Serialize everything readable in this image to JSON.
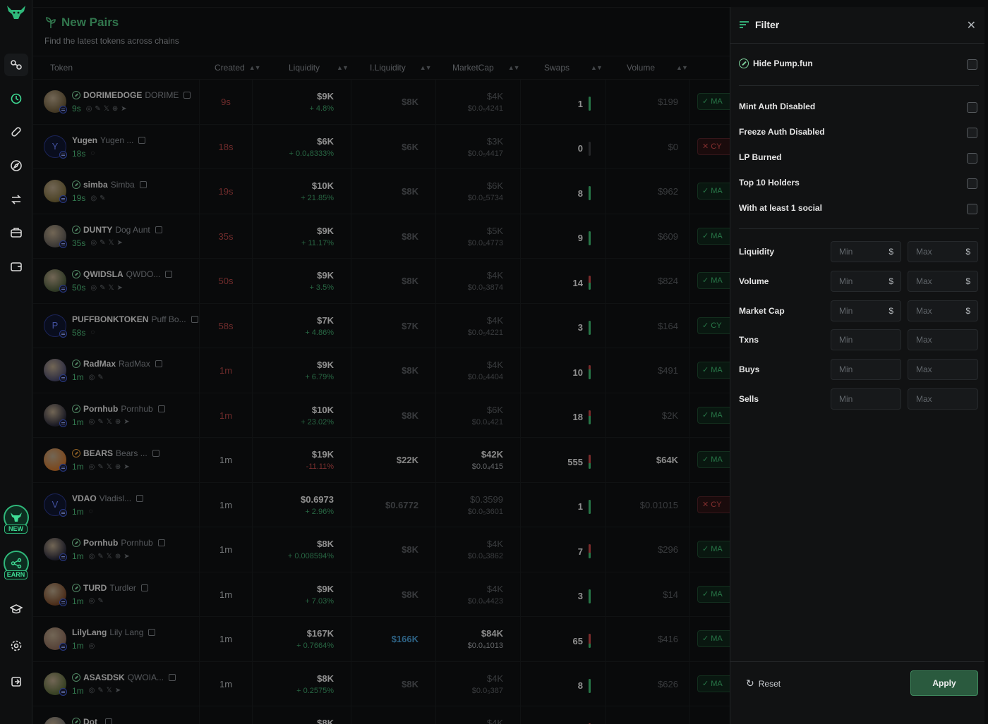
{
  "page": {
    "title": "New Pairs",
    "subtitle": "Find the latest tokens across chains"
  },
  "rail": {
    "promo_new": "NEW",
    "promo_earn": "EARN"
  },
  "table": {
    "headers": {
      "token": "Token",
      "created": "Created",
      "liquidity": "Liquidity",
      "iliquidity": "I.Liquidity",
      "marketcap": "MarketCap",
      "swaps": "Swaps",
      "volume": "Volume"
    },
    "rows": [
      {
        "sym": "DORIMEDOGE",
        "name": "DORIME",
        "age": "9s",
        "created": "9s",
        "created_style": "red",
        "liq": "$9K",
        "liq_chg": "+ 4.8%",
        "liq_neg": false,
        "iliq": "$8K",
        "iliq_style": "",
        "mc": "$4K",
        "mc_sub": "$0.0₅4241",
        "mc_white": false,
        "swaps": "1",
        "buy_ratio": 1.0,
        "vol": "$199",
        "vol_white": false,
        "audit": "✓ MA",
        "audit_bad": false,
        "avatar": "img",
        "pump": true,
        "pump_orange": false,
        "meta": [
          "◎",
          "✎",
          "𝕏",
          "⊕",
          "➤"
        ]
      },
      {
        "sym": "Yugen",
        "name": "Yugen ...",
        "age": "18s",
        "created": "18s",
        "created_style": "red",
        "liq": "$6K",
        "liq_chg": "+ 0.0₄8333%",
        "liq_neg": false,
        "iliq": "$6K",
        "iliq_style": "",
        "mc": "$3K",
        "mc_sub": "$0.0₅4417",
        "mc_white": false,
        "swaps": "0",
        "buy_ratio": 0,
        "vol": "$0",
        "vol_white": false,
        "audit": "✕ CY",
        "audit_bad": true,
        "avatar": "Y",
        "pump": false,
        "pump_orange": false,
        "meta": [
          "◌"
        ]
      },
      {
        "sym": "simba",
        "name": "Simba",
        "age": "19s",
        "created": "19s",
        "created_style": "red",
        "liq": "$10K",
        "liq_chg": "+ 21.85%",
        "liq_neg": false,
        "iliq": "$8K",
        "iliq_style": "",
        "mc": "$6K",
        "mc_sub": "$0.0₅5734",
        "mc_white": false,
        "swaps": "8",
        "buy_ratio": 1.0,
        "vol": "$962",
        "vol_white": false,
        "audit": "✓ MA",
        "audit_bad": false,
        "avatar": "img",
        "pump": true,
        "pump_orange": false,
        "meta": [
          "◎",
          "✎"
        ]
      },
      {
        "sym": "DUNTY",
        "name": "Dog Aunt",
        "age": "35s",
        "created": "35s",
        "created_style": "red",
        "liq": "$9K",
        "liq_chg": "+ 11.17%",
        "liq_neg": false,
        "iliq": "$8K",
        "iliq_style": "",
        "mc": "$5K",
        "mc_sub": "$0.0₅4773",
        "mc_white": false,
        "swaps": "9",
        "buy_ratio": 1.0,
        "vol": "$609",
        "vol_white": false,
        "audit": "✓ MA",
        "audit_bad": false,
        "avatar": "img",
        "pump": true,
        "pump_orange": false,
        "meta": [
          "◎",
          "✎",
          "𝕏",
          "➤"
        ]
      },
      {
        "sym": "QWIDSLA",
        "name": "QWDO...",
        "age": "50s",
        "created": "50s",
        "created_style": "red",
        "liq": "$9K",
        "liq_chg": "+ 3.5%",
        "liq_neg": false,
        "iliq": "$8K",
        "iliq_style": "",
        "mc": "$4K",
        "mc_sub": "$0.0₅3874",
        "mc_white": false,
        "swaps": "14",
        "buy_ratio": 0.5,
        "vol": "$824",
        "vol_white": false,
        "audit": "✓ MA",
        "audit_bad": false,
        "avatar": "img",
        "pump": true,
        "pump_orange": false,
        "meta": [
          "◎",
          "✎",
          "𝕏",
          "➤"
        ]
      },
      {
        "sym": "PUFFBONKTOKEN",
        "name": "Puff Bo...",
        "age": "58s",
        "created": "58s",
        "created_style": "red",
        "liq": "$7K",
        "liq_chg": "+ 4.86%",
        "liq_neg": false,
        "iliq": "$7K",
        "iliq_style": "",
        "mc": "$4K",
        "mc_sub": "$0.0₅4221",
        "mc_white": false,
        "swaps": "3",
        "buy_ratio": 1.0,
        "vol": "$164",
        "vol_white": false,
        "audit": "✓ CY",
        "audit_bad": false,
        "avatar": "P",
        "pump": false,
        "pump_orange": false,
        "meta": [
          "◌"
        ]
      },
      {
        "sym": "RadMax",
        "name": "RadMax",
        "age": "1m",
        "created": "1m",
        "created_style": "red",
        "liq": "$9K",
        "liq_chg": "+ 6.79%",
        "liq_neg": false,
        "iliq": "$8K",
        "iliq_style": "",
        "mc": "$4K",
        "mc_sub": "$0.0₅4404",
        "mc_white": false,
        "swaps": "10",
        "buy_ratio": 0.7,
        "vol": "$491",
        "vol_white": false,
        "audit": "✓ MA",
        "audit_bad": false,
        "avatar": "img",
        "pump": true,
        "pump_orange": false,
        "meta": [
          "◎",
          "✎"
        ]
      },
      {
        "sym": "Pornhub",
        "name": "Pornhub",
        "age": "1m",
        "created": "1m",
        "created_style": "red",
        "liq": "$10K",
        "liq_chg": "+ 23.02%",
        "liq_neg": false,
        "iliq": "$8K",
        "iliq_style": "",
        "mc": "$6K",
        "mc_sub": "$0.0₅421",
        "mc_white": false,
        "swaps": "18",
        "buy_ratio": 0.6,
        "vol": "$2K",
        "vol_white": false,
        "audit": "✓ MA",
        "audit_bad": false,
        "avatar": "img",
        "pump": true,
        "pump_orange": false,
        "meta": [
          "◎",
          "✎",
          "𝕏",
          "⊕",
          "➤"
        ]
      },
      {
        "sym": "BEARS",
        "name": "Bears ...",
        "age": "1m",
        "created": "1m",
        "created_style": "grey",
        "liq": "$19K",
        "liq_chg": "-11.11%",
        "liq_neg": true,
        "iliq": "$22K",
        "iliq_style": "white",
        "mc": "$42K",
        "mc_sub": "$0.0₄415",
        "mc_white": true,
        "swaps": "555",
        "buy_ratio": 0.4,
        "vol": "$64K",
        "vol_white": true,
        "audit": "✓ MA",
        "audit_bad": false,
        "avatar": "img",
        "pump": true,
        "pump_orange": true,
        "meta": [
          "◎",
          "✎",
          "𝕏",
          "⊕",
          "➤"
        ]
      },
      {
        "sym": "VDAO",
        "name": "Vladisl...",
        "age": "1m",
        "created": "1m",
        "created_style": "grey",
        "liq": "$0.6973",
        "liq_chg": "+ 2.96%",
        "liq_neg": false,
        "iliq": "$0.6772",
        "iliq_style": "",
        "mc": "$0.3599",
        "mc_sub": "$0.0₅3601",
        "mc_white": false,
        "swaps": "1",
        "buy_ratio": 1.0,
        "vol": "$0.01015",
        "vol_white": false,
        "audit": "✕ CY",
        "audit_bad": true,
        "avatar": "V",
        "pump": false,
        "pump_orange": false,
        "meta": [
          "◌"
        ]
      },
      {
        "sym": "Pornhub",
        "name": "Pornhub",
        "age": "1m",
        "created": "1m",
        "created_style": "grey",
        "liq": "$8K",
        "liq_chg": "+ 0.008594%",
        "liq_neg": false,
        "iliq": "$8K",
        "iliq_style": "",
        "mc": "$4K",
        "mc_sub": "$0.0₅3862",
        "mc_white": false,
        "swaps": "7",
        "buy_ratio": 0.4,
        "vol": "$296",
        "vol_white": false,
        "audit": "✓ MA",
        "audit_bad": false,
        "avatar": "img",
        "pump": true,
        "pump_orange": false,
        "meta": [
          "◎",
          "✎",
          "𝕏",
          "⊕",
          "➤"
        ]
      },
      {
        "sym": "TURD",
        "name": "Turdler",
        "age": "1m",
        "created": "1m",
        "created_style": "grey",
        "liq": "$9K",
        "liq_chg": "+ 7.03%",
        "liq_neg": false,
        "iliq": "$8K",
        "iliq_style": "",
        "mc": "$4K",
        "mc_sub": "$0.0₅4423",
        "mc_white": false,
        "swaps": "3",
        "buy_ratio": 1.0,
        "vol": "$14",
        "vol_white": false,
        "audit": "✓ MA",
        "audit_bad": false,
        "avatar": "img",
        "pump": true,
        "pump_orange": false,
        "meta": [
          "◎",
          "✎"
        ]
      },
      {
        "sym": "LilyLang",
        "name": "Lily Lang",
        "age": "1m",
        "created": "1m",
        "created_style": "grey",
        "liq": "$167K",
        "liq_chg": "+ 0.7664%",
        "liq_neg": false,
        "iliq": "$166K",
        "iliq_style": "blue",
        "mc": "$84K",
        "mc_sub": "$0.0₄1013",
        "mc_white": true,
        "swaps": "65",
        "buy_ratio": 0.3,
        "vol": "$416",
        "vol_white": false,
        "audit": "✓ MA",
        "audit_bad": false,
        "avatar": "img",
        "pump": false,
        "pump_orange": false,
        "meta": [
          "◎"
        ]
      },
      {
        "sym": "ASASDSK",
        "name": "QWOIA...",
        "age": "1m",
        "created": "1m",
        "created_style": "grey",
        "liq": "$8K",
        "liq_chg": "+ 0.2575%",
        "liq_neg": false,
        "iliq": "$8K",
        "iliq_style": "",
        "mc": "$4K",
        "mc_sub": "$0.0₅387",
        "mc_white": false,
        "swaps": "8",
        "buy_ratio": 1.0,
        "vol": "$626",
        "vol_white": false,
        "audit": "✓ MA",
        "audit_bad": false,
        "avatar": "img",
        "pump": true,
        "pump_orange": false,
        "meta": [
          "◎",
          "✎",
          "𝕏",
          "➤"
        ]
      },
      {
        "sym": "Dot",
        "name": "",
        "age": "",
        "created": "",
        "created_style": "grey",
        "liq": "$8K",
        "liq_chg": "",
        "liq_neg": false,
        "iliq": "",
        "iliq_style": "",
        "mc": "$4K",
        "mc_sub": "",
        "mc_white": false,
        "swaps": "",
        "buy_ratio": 0.5,
        "vol": "",
        "vol_white": false,
        "audit": "",
        "audit_bad": false,
        "avatar": "img",
        "pump": true,
        "pump_orange": false,
        "meta": []
      }
    ]
  },
  "filter": {
    "title": "Filter",
    "hide_pump": "Hide Pump.fun",
    "checks": [
      "Mint Auth Disabled",
      "Freeze Auth Disabled",
      "LP Burned",
      "Top 10 Holders",
      "With at least 1 social"
    ],
    "ranges": [
      {
        "label": "Liquidity",
        "min": "Min",
        "max": "Max",
        "currency": "$"
      },
      {
        "label": "Volume",
        "min": "Min",
        "max": "Max",
        "currency": "$"
      },
      {
        "label": "Market Cap",
        "min": "Min",
        "max": "Max",
        "currency": "$"
      },
      {
        "label": "Txns",
        "min": "Min",
        "max": "Max",
        "currency": ""
      },
      {
        "label": "Buys",
        "min": "Min",
        "max": "Max",
        "currency": ""
      },
      {
        "label": "Sells",
        "min": "Min",
        "max": "Max",
        "currency": ""
      }
    ],
    "reset": "Reset",
    "apply": "Apply"
  },
  "colors": {
    "accent": "#4fbf7c",
    "buy": "#3fbf73",
    "sell": "#c84646",
    "apply_bg": "#2a5a3e"
  }
}
